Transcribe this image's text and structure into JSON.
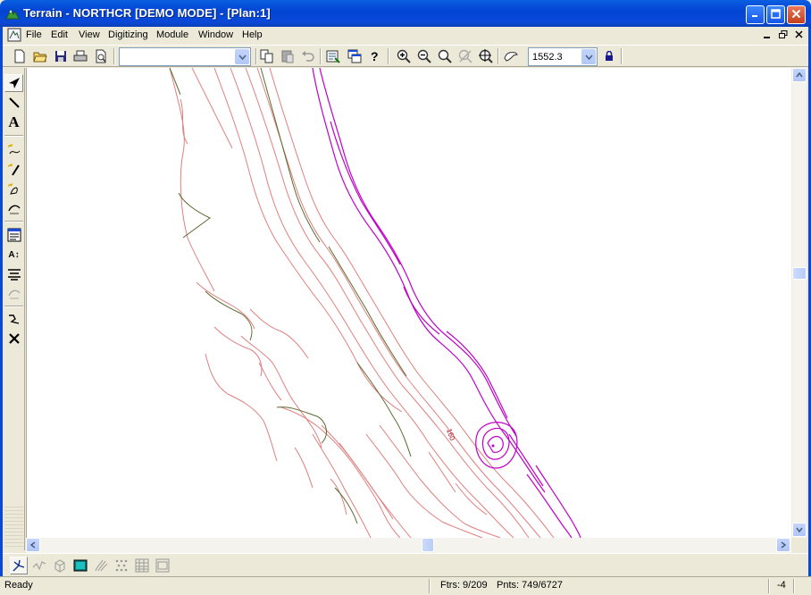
{
  "window": {
    "title": "Terrain - NORTHCR [DEMO MODE] - [Plan:1]",
    "colors": {
      "titlebar": "#0a4ad8",
      "face": "#ece9d8",
      "contour_major": "#5b6b2e",
      "contour_minor": "#e07f7f",
      "contour_magenta": "#c000c8",
      "contour_label": "#b00020"
    }
  },
  "menu": {
    "items": [
      "File",
      "Edit",
      "View",
      "Digitizing",
      "Module",
      "Window",
      "Help"
    ]
  },
  "toolbar": {
    "layer_combo_value": "",
    "scale_combo_value": "1552.3",
    "icons": [
      "new-icon",
      "open-icon",
      "save-icon",
      "print-icon",
      "print-preview-icon",
      "copy-icon",
      "paste-icon",
      "undo-icon",
      "properties-icon",
      "window-icon",
      "help-icon",
      "zoom-in-icon",
      "zoom-out-icon",
      "zoom-icon",
      "zoom-disabled-icon",
      "zoom-extents-icon",
      "pan-icon",
      "lock-icon"
    ]
  },
  "map": {
    "contour_label": "160"
  },
  "status": {
    "ready": "Ready",
    "features": "Ftrs: 9/209",
    "points": "Pnts: 749/6727",
    "coord": "-4"
  }
}
